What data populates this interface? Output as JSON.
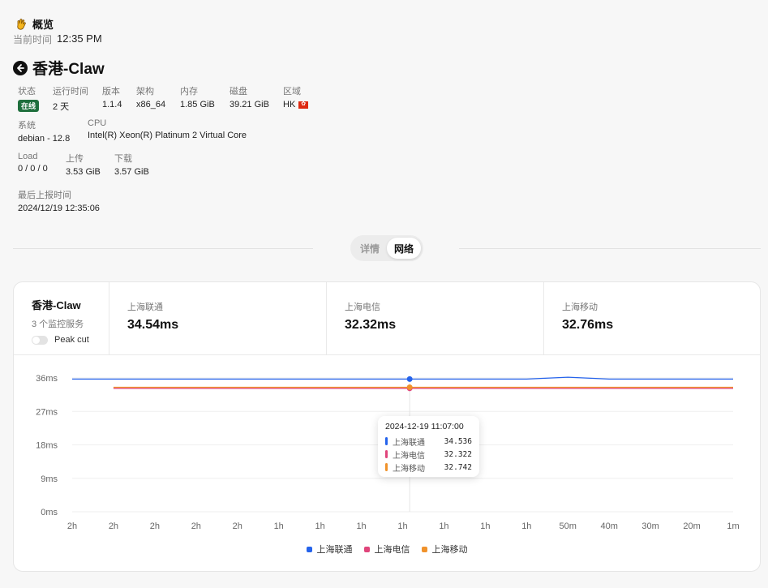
{
  "header": {
    "emoji": "👋",
    "title": "概览",
    "time_label": "当前时间",
    "time_value": "12:35 PM"
  },
  "server": {
    "name": "香港-Claw"
  },
  "info": {
    "status": {
      "label": "状态",
      "value": "在线"
    },
    "uptime": {
      "label": "运行时间",
      "value": "2 天"
    },
    "version": {
      "label": "版本",
      "value": "1.1.4"
    },
    "arch": {
      "label": "架构",
      "value": "x86_64"
    },
    "memory": {
      "label": "内存",
      "value": "1.85 GiB"
    },
    "disk": {
      "label": "磁盘",
      "value": "39.21 GiB"
    },
    "region": {
      "label": "区域",
      "value": "HK"
    },
    "os": {
      "label": "系统",
      "value": "debian - 12.8"
    },
    "cpu": {
      "label": "CPU",
      "value": "Intel(R) Xeon(R) Platinum 2 Virtual Core"
    },
    "load": {
      "label": "Load",
      "value": "0 / 0 / 0"
    },
    "upload": {
      "label": "上传",
      "value": "3.53 GiB"
    },
    "download": {
      "label": "下载",
      "value": "3.57 GiB"
    },
    "last_report": {
      "label": "最后上报时间",
      "value": "2024/12/19 12:35:06"
    }
  },
  "tabs": [
    {
      "label": "详情",
      "active": false
    },
    {
      "label": "网络",
      "active": true
    }
  ],
  "monitor": {
    "server_name": "香港-Claw",
    "service_count": "3 个监控服务",
    "peak_cut_label": "Peak cut",
    "peak_cut_on": false,
    "isps": [
      {
        "name": "上海联通",
        "latency": "34.54ms"
      },
      {
        "name": "上海电信",
        "latency": "32.32ms"
      },
      {
        "name": "上海移动",
        "latency": "32.76ms"
      }
    ]
  },
  "colors": {
    "unicom": "#2563eb",
    "telecom": "#e0457b",
    "mobile": "#f0922b",
    "badge": "#1f6f3d"
  },
  "chart_data": {
    "type": "line",
    "y_ticks": [
      "36ms",
      "27ms",
      "18ms",
      "9ms",
      "0ms"
    ],
    "ylim": [
      0,
      36
    ],
    "x_ticks": [
      "2h",
      "2h",
      "2h",
      "2h",
      "2h",
      "1h",
      "1h",
      "1h",
      "1h",
      "1h",
      "1h",
      "1h",
      "50m",
      "40m",
      "30m",
      "20m",
      "1m"
    ],
    "series": [
      {
        "name": "上海联通",
        "color": "#2563eb",
        "values": [
          35.7,
          35.7,
          35.7,
          35.7,
          35.7,
          35.7,
          35.7,
          35.7,
          35.7,
          35.7,
          35.7,
          35.7,
          36.2,
          35.7,
          35.7,
          35.7,
          35.7
        ]
      },
      {
        "name": "上海电信",
        "color": "#e0457b",
        "values": [
          null,
          33.2,
          33.2,
          33.2,
          33.2,
          33.2,
          33.2,
          33.2,
          33.2,
          33.2,
          33.2,
          33.2,
          33.2,
          33.2,
          33.2,
          33.2,
          33.2
        ]
      },
      {
        "name": "上海移动",
        "color": "#f0922b",
        "values": [
          null,
          33.5,
          33.5,
          33.5,
          33.5,
          33.5,
          33.5,
          33.5,
          33.5,
          33.5,
          33.5,
          33.5,
          33.5,
          33.5,
          33.5,
          33.5,
          33.5
        ]
      }
    ],
    "tooltip": {
      "time": "2024-12-19 11:07:00",
      "rows": [
        {
          "name": "上海联通",
          "value": "34.536",
          "color": "#2563eb"
        },
        {
          "name": "上海电信",
          "value": "32.322",
          "color": "#e0457b"
        },
        {
          "name": "上海移动",
          "value": "32.742",
          "color": "#f0922b"
        }
      ]
    },
    "legend": [
      {
        "name": "上海联通",
        "color": "#2563eb"
      },
      {
        "name": "上海电信",
        "color": "#e0457b"
      },
      {
        "name": "上海移动",
        "color": "#f0922b"
      }
    ]
  }
}
